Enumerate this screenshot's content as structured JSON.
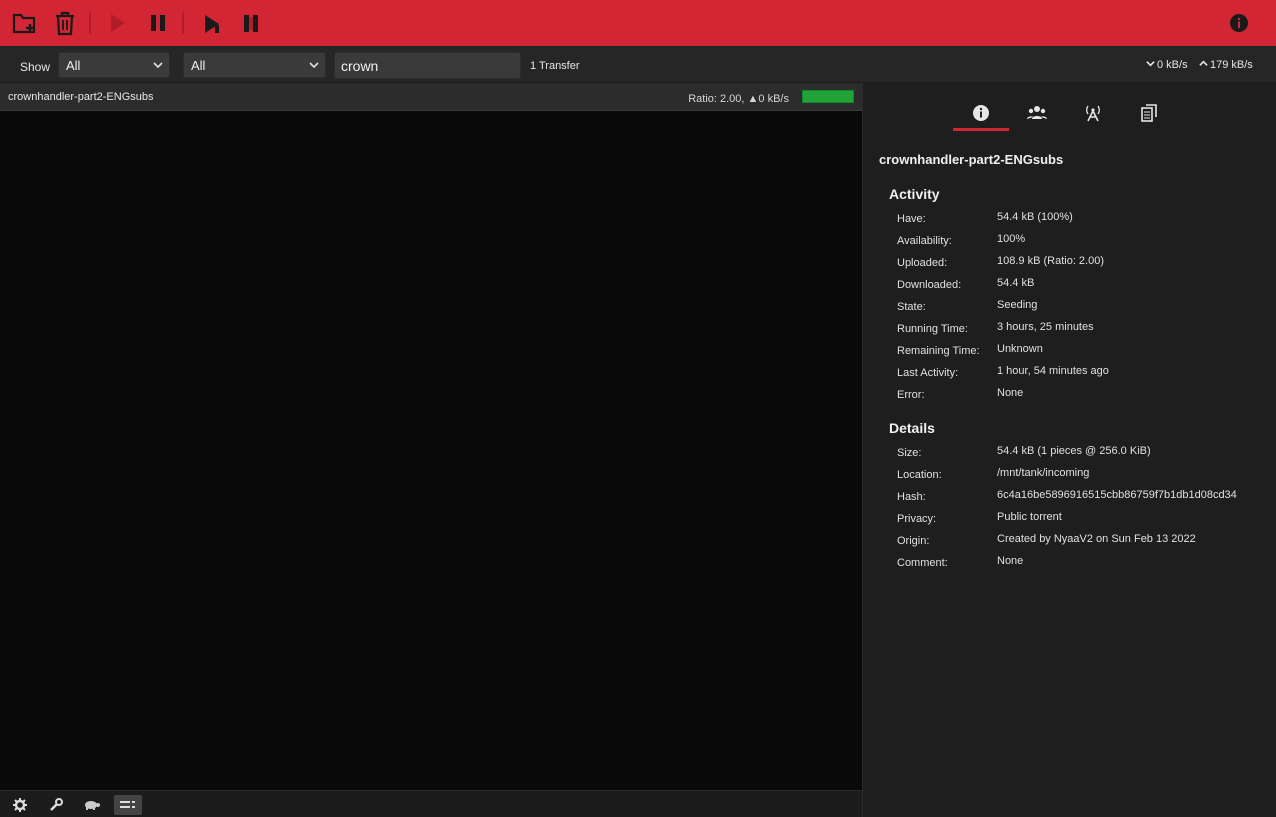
{
  "toolbar": {
    "buttons": [
      {
        "name": "open-torrent-icon",
        "enabled": true
      },
      {
        "name": "remove-torrent-icon",
        "enabled": true
      },
      {
        "name": "start-icon",
        "enabled": false
      },
      {
        "name": "pause-icon",
        "enabled": true
      },
      {
        "name": "start-all-icon",
        "enabled": true
      },
      {
        "name": "pause-all-icon",
        "enabled": true
      },
      {
        "name": "info-icon",
        "enabled": true
      }
    ],
    "color": "#d32634"
  },
  "filter": {
    "show_label": "Show",
    "status_filter": "All",
    "tracker_filter": "All",
    "search_value": "crown",
    "transfer_count": "1 Transfer",
    "download_speed": "0 kB/s",
    "upload_speed": "179 kB/s"
  },
  "torrents": [
    {
      "name": "crownhandler-part2-ENGsubs",
      "status": "Ratio: 2.00, ▲0 kB/s",
      "progress": 1.0
    }
  ],
  "inspector": {
    "tabs": [
      "info-tab",
      "peers-tab",
      "trackers-tab",
      "files-tab"
    ],
    "title": "crownhandler-part2-ENGsubs",
    "activity": {
      "heading": "Activity",
      "rows": [
        {
          "label": "Have:",
          "value": "54.4 kB (100%)"
        },
        {
          "label": "Availability:",
          "value": "100%"
        },
        {
          "label": "Uploaded:",
          "value": "108.9 kB (Ratio: 2.00)"
        },
        {
          "label": "Downloaded:",
          "value": "54.4 kB"
        },
        {
          "label": "State:",
          "value": "Seeding"
        },
        {
          "label": "Running Time:",
          "value": "3 hours, 25 minutes"
        },
        {
          "label": "Remaining Time:",
          "value": "Unknown"
        },
        {
          "label": "Last Activity:",
          "value": "1 hour, 54 minutes ago"
        },
        {
          "label": "Error:",
          "value": "None"
        }
      ]
    },
    "details": {
      "heading": "Details",
      "rows": [
        {
          "label": "Size:",
          "value": "54.4 kB (1 pieces @ 256.0 KiB)"
        },
        {
          "label": "Location:",
          "value": "/mnt/tank/incoming"
        },
        {
          "label": "Hash:",
          "value": "6c4a16be5896916515cbb86759f7b1db1d08cd34"
        },
        {
          "label": "Privacy:",
          "value": "Public torrent"
        },
        {
          "label": "Origin:",
          "value": "Created by NyaaV2 on Sun Feb 13 2022"
        },
        {
          "label": "Comment:",
          "value": "None"
        }
      ]
    }
  },
  "footer": {
    "buttons": [
      "settings-icon",
      "wrench-icon",
      "turtle-icon",
      "compact-view-icon"
    ]
  }
}
